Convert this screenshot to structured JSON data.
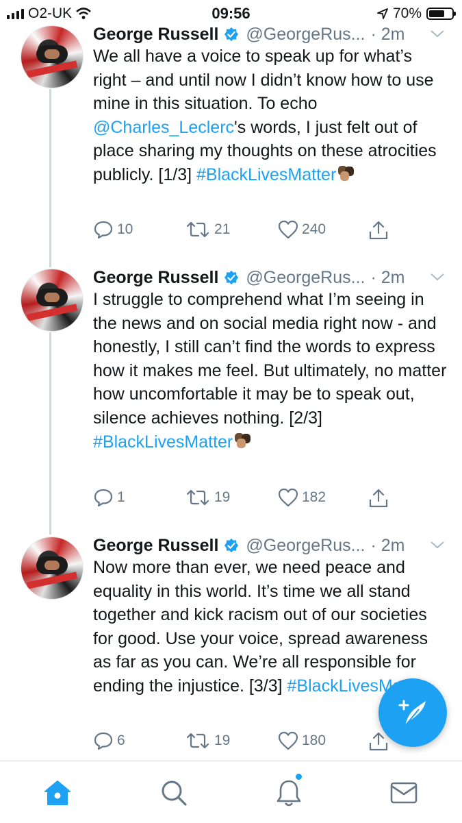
{
  "status_bar": {
    "carrier": "O2-UK",
    "time": "09:56",
    "battery": "70%",
    "battery_level": 0.7
  },
  "tweets": [
    {
      "name": "George Russell",
      "handle": "@GeorgeRus...",
      "time": "· 2m",
      "text_parts": [
        "We all have a voice to speak up for what’s right – and until now I didn’t know how to use mine in this situation. To echo ",
        "@Charles_Leclerc",
        "'s words, I just felt out of place sharing my thoughts on these atrocities publicly. [1/3] ",
        "#BlackLivesMatter"
      ],
      "replies": "10",
      "retweets": "21",
      "likes": "240"
    },
    {
      "name": "George Russell",
      "handle": "@GeorgeRus...",
      "time": "· 2m",
      "text_parts": [
        "I struggle to comprehend what I’m seeing in the news and on social media right now - and honestly, I still can’t find the words to express how it makes me feel. But ultimately, no matter how uncomfortable it may be to speak out, silence achieves nothing. [2/3] ",
        "#BlackLivesMatter"
      ],
      "replies": "1",
      "retweets": "19",
      "likes": "182"
    },
    {
      "name": "George Russell",
      "handle": "@GeorgeRus...",
      "time": "· 2m",
      "text_parts": [
        "Now more than ever, we need peace and equality in this world. It’s time we all stand together and kick racism out of our societies for good. Use your voice, spread awareness as far as you can. We’re all responsible for ending the injustice. [3/3] ",
        "#BlackLivesMatter"
      ],
      "replies": "6",
      "retweets": "19",
      "likes": "180"
    }
  ],
  "icons": {
    "reply": "reply-icon",
    "retweet": "retweet-icon",
    "like": "heart-icon",
    "share": "share-icon",
    "compose": "compose-tweet-icon",
    "home": "home-icon",
    "search": "search-icon",
    "notifications": "bell-icon",
    "messages": "mail-icon"
  },
  "colors": {
    "accent": "#1da1f2",
    "text": "#14171a",
    "secondary": "#657786"
  }
}
